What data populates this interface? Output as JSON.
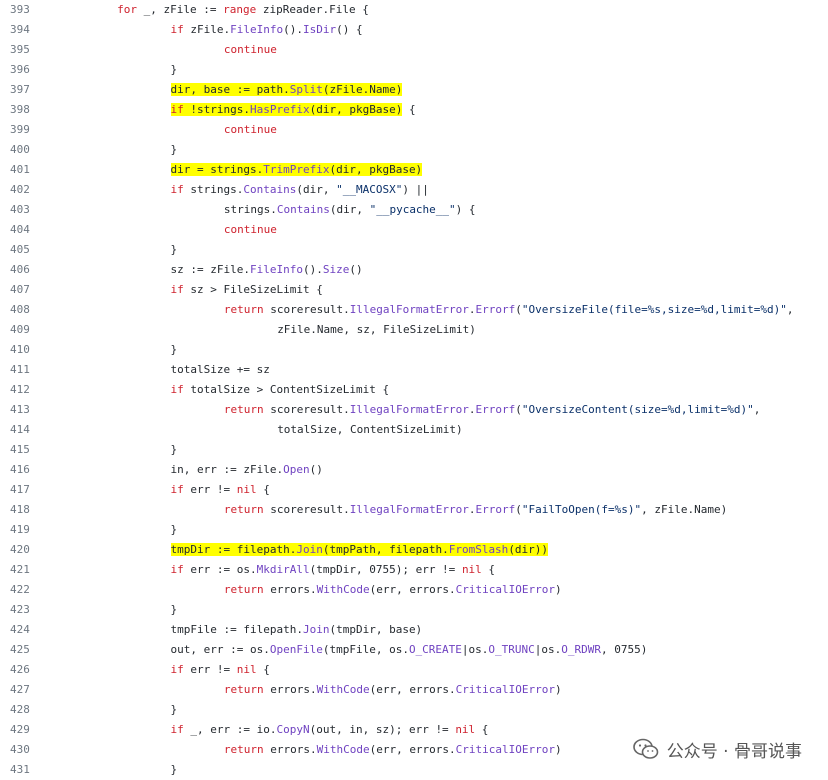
{
  "lines": [
    {
      "n": "393",
      "indent": 14,
      "tokens": [
        {
          "t": "for",
          "c": "kw"
        },
        {
          "t": " _, zFile := "
        },
        {
          "t": "range",
          "c": "kw"
        },
        {
          "t": " zipReader.File {"
        }
      ]
    },
    {
      "n": "394",
      "indent": 21,
      "tokens": [
        {
          "t": "if",
          "c": "kw"
        },
        {
          "t": " zFile."
        },
        {
          "t": "FileInfo",
          "c": "fn"
        },
        {
          "t": "()."
        },
        {
          "t": "IsDir",
          "c": "fn"
        },
        {
          "t": "() {"
        }
      ]
    },
    {
      "n": "395",
      "indent": 28,
      "tokens": [
        {
          "t": "continue",
          "c": "kw"
        }
      ]
    },
    {
      "n": "396",
      "indent": 21,
      "tokens": [
        {
          "t": "}"
        }
      ]
    },
    {
      "n": "397",
      "indent": 21,
      "highlight": true,
      "tokens": [
        {
          "t": "dir, base := path."
        },
        {
          "t": "Split",
          "c": "fn"
        },
        {
          "t": "(zFile.Name)"
        }
      ]
    },
    {
      "n": "398",
      "indent": 21,
      "highlight": true,
      "tokens": [
        {
          "t": "if",
          "c": "kw"
        },
        {
          "t": " !strings."
        },
        {
          "t": "HasPrefix",
          "c": "fn"
        },
        {
          "t": "(dir, pkgBase)"
        }
      ],
      "tail": " {"
    },
    {
      "n": "399",
      "indent": 28,
      "tokens": [
        {
          "t": "continue",
          "c": "kw"
        }
      ]
    },
    {
      "n": "400",
      "indent": 21,
      "tokens": [
        {
          "t": "}"
        }
      ]
    },
    {
      "n": "401",
      "indent": 21,
      "highlight": true,
      "tokens": [
        {
          "t": "dir = strings."
        },
        {
          "t": "TrimPrefix",
          "c": "fn"
        },
        {
          "t": "(dir, pkgBase)"
        }
      ]
    },
    {
      "n": "402",
      "indent": 21,
      "tokens": [
        {
          "t": "if",
          "c": "kw"
        },
        {
          "t": " strings."
        },
        {
          "t": "Contains",
          "c": "fn"
        },
        {
          "t": "(dir, "
        },
        {
          "t": "\"__MACOSX\"",
          "c": "str"
        },
        {
          "t": ") ||"
        }
      ]
    },
    {
      "n": "403",
      "indent": 28,
      "tokens": [
        {
          "t": "strings."
        },
        {
          "t": "Contains",
          "c": "fn"
        },
        {
          "t": "(dir, "
        },
        {
          "t": "\"__pycache__\"",
          "c": "str"
        },
        {
          "t": ") {"
        }
      ]
    },
    {
      "n": "404",
      "indent": 28,
      "tokens": [
        {
          "t": "continue",
          "c": "kw"
        }
      ]
    },
    {
      "n": "405",
      "indent": 21,
      "tokens": [
        {
          "t": "}"
        }
      ]
    },
    {
      "n": "406",
      "indent": 21,
      "tokens": [
        {
          "t": "sz := zFile."
        },
        {
          "t": "FileInfo",
          "c": "fn"
        },
        {
          "t": "()."
        },
        {
          "t": "Size",
          "c": "fn"
        },
        {
          "t": "()"
        }
      ]
    },
    {
      "n": "407",
      "indent": 21,
      "tokens": [
        {
          "t": "if",
          "c": "kw"
        },
        {
          "t": " sz > FileSizeLimit {"
        }
      ]
    },
    {
      "n": "408",
      "indent": 28,
      "tokens": [
        {
          "t": "return",
          "c": "kw"
        },
        {
          "t": " scoreresult."
        },
        {
          "t": "IllegalFormatError",
          "c": "fn"
        },
        {
          "t": "."
        },
        {
          "t": "Errorf",
          "c": "fn"
        },
        {
          "t": "("
        },
        {
          "t": "\"OversizeFile(file=%s,size=%d,limit=%d)\"",
          "c": "str"
        },
        {
          "t": ","
        }
      ]
    },
    {
      "n": "409",
      "indent": 35,
      "tokens": [
        {
          "t": "zFile.Name, sz, FileSizeLimit)"
        }
      ]
    },
    {
      "n": "410",
      "indent": 21,
      "tokens": [
        {
          "t": "}"
        }
      ]
    },
    {
      "n": "411",
      "indent": 21,
      "tokens": [
        {
          "t": "totalSize += sz"
        }
      ]
    },
    {
      "n": "412",
      "indent": 21,
      "tokens": [
        {
          "t": "if",
          "c": "kw"
        },
        {
          "t": " totalSize > ContentSizeLimit {"
        }
      ]
    },
    {
      "n": "413",
      "indent": 28,
      "tokens": [
        {
          "t": "return",
          "c": "kw"
        },
        {
          "t": " scoreresult."
        },
        {
          "t": "IllegalFormatError",
          "c": "fn"
        },
        {
          "t": "."
        },
        {
          "t": "Errorf",
          "c": "fn"
        },
        {
          "t": "("
        },
        {
          "t": "\"OversizeContent(size=%d,limit=%d)\"",
          "c": "str"
        },
        {
          "t": ","
        }
      ]
    },
    {
      "n": "414",
      "indent": 35,
      "tokens": [
        {
          "t": "totalSize, ContentSizeLimit)"
        }
      ]
    },
    {
      "n": "415",
      "indent": 21,
      "tokens": [
        {
          "t": "}"
        }
      ]
    },
    {
      "n": "416",
      "indent": 21,
      "tokens": [
        {
          "t": "in, err := zFile."
        },
        {
          "t": "Open",
          "c": "fn"
        },
        {
          "t": "()"
        }
      ]
    },
    {
      "n": "417",
      "indent": 21,
      "tokens": [
        {
          "t": "if",
          "c": "kw"
        },
        {
          "t": " err != "
        },
        {
          "t": "nil",
          "c": "kw"
        },
        {
          "t": " {"
        }
      ]
    },
    {
      "n": "418",
      "indent": 28,
      "tokens": [
        {
          "t": "return",
          "c": "kw"
        },
        {
          "t": " scoreresult."
        },
        {
          "t": "IllegalFormatError",
          "c": "fn"
        },
        {
          "t": "."
        },
        {
          "t": "Errorf",
          "c": "fn"
        },
        {
          "t": "("
        },
        {
          "t": "\"FailToOpen(f=%s)\"",
          "c": "str"
        },
        {
          "t": ", zFile.Name)"
        }
      ]
    },
    {
      "n": "419",
      "indent": 21,
      "tokens": [
        {
          "t": "}"
        }
      ]
    },
    {
      "n": "420",
      "indent": 21,
      "highlight": true,
      "tokens": [
        {
          "t": "tmpDir := filepath."
        },
        {
          "t": "Join",
          "c": "fn"
        },
        {
          "t": "(tmpPath, filepath."
        },
        {
          "t": "FromSlash",
          "c": "fn"
        },
        {
          "t": "(dir))"
        }
      ]
    },
    {
      "n": "421",
      "indent": 21,
      "tokens": [
        {
          "t": "if",
          "c": "kw"
        },
        {
          "t": " err := os."
        },
        {
          "t": "MkdirAll",
          "c": "fn"
        },
        {
          "t": "(tmpDir, 0755); err != "
        },
        {
          "t": "nil",
          "c": "kw"
        },
        {
          "t": " {"
        }
      ]
    },
    {
      "n": "422",
      "indent": 28,
      "tokens": [
        {
          "t": "return",
          "c": "kw"
        },
        {
          "t": " errors."
        },
        {
          "t": "WithCode",
          "c": "fn"
        },
        {
          "t": "(err, errors."
        },
        {
          "t": "CriticalIOError",
          "c": "fn"
        },
        {
          "t": ")"
        }
      ]
    },
    {
      "n": "423",
      "indent": 21,
      "tokens": [
        {
          "t": "}"
        }
      ]
    },
    {
      "n": "424",
      "indent": 21,
      "tokens": [
        {
          "t": "tmpFile := filepath."
        },
        {
          "t": "Join",
          "c": "fn"
        },
        {
          "t": "(tmpDir, base)"
        }
      ]
    },
    {
      "n": "425",
      "indent": 21,
      "tokens": [
        {
          "t": "out, err := os."
        },
        {
          "t": "OpenFile",
          "c": "fn"
        },
        {
          "t": "(tmpFile, os."
        },
        {
          "t": "O_CREATE",
          "c": "fn"
        },
        {
          "t": "|os."
        },
        {
          "t": "O_TRUNC",
          "c": "fn"
        },
        {
          "t": "|os."
        },
        {
          "t": "O_RDWR",
          "c": "fn"
        },
        {
          "t": ", 0755)"
        }
      ]
    },
    {
      "n": "426",
      "indent": 21,
      "tokens": [
        {
          "t": "if",
          "c": "kw"
        },
        {
          "t": " err != "
        },
        {
          "t": "nil",
          "c": "kw"
        },
        {
          "t": " {"
        }
      ]
    },
    {
      "n": "427",
      "indent": 28,
      "tokens": [
        {
          "t": "return",
          "c": "kw"
        },
        {
          "t": " errors."
        },
        {
          "t": "WithCode",
          "c": "fn"
        },
        {
          "t": "(err, errors."
        },
        {
          "t": "CriticalIOError",
          "c": "fn"
        },
        {
          "t": ")"
        }
      ]
    },
    {
      "n": "428",
      "indent": 21,
      "tokens": [
        {
          "t": "}"
        }
      ]
    },
    {
      "n": "429",
      "indent": 21,
      "tokens": [
        {
          "t": "if",
          "c": "kw"
        },
        {
          "t": " _, err := io."
        },
        {
          "t": "CopyN",
          "c": "fn"
        },
        {
          "t": "(out, in, sz); err != "
        },
        {
          "t": "nil",
          "c": "kw"
        },
        {
          "t": " {"
        }
      ]
    },
    {
      "n": "430",
      "indent": 28,
      "tokens": [
        {
          "t": "return",
          "c": "kw"
        },
        {
          "t": " errors."
        },
        {
          "t": "WithCode",
          "c": "fn"
        },
        {
          "t": "(err, errors."
        },
        {
          "t": "CriticalIOError",
          "c": "fn"
        },
        {
          "t": ")"
        }
      ]
    },
    {
      "n": "431",
      "indent": 21,
      "tokens": [
        {
          "t": "}"
        }
      ]
    }
  ],
  "colors": {
    "keyword": "#cf222e",
    "function": "#6f42c1",
    "string": "#0a3069",
    "highlight": "#ffff00",
    "line_number": "#6e7781"
  },
  "watermark": {
    "text": "公众号 · 骨哥说事",
    "icon": "wechat-icon"
  }
}
